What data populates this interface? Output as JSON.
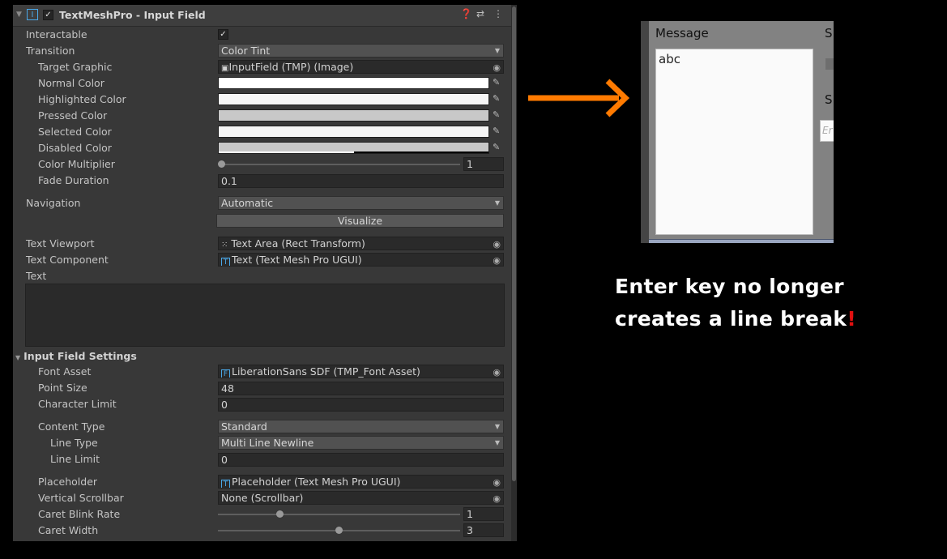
{
  "component": {
    "title": "TextMeshPro - Input Field",
    "icon": "tmp-component-icon",
    "enabled": true,
    "header_icons": [
      "help-icon",
      "presets-icon",
      "menu-icon"
    ]
  },
  "props": {
    "interactable": {
      "label": "Interactable",
      "checked": true
    },
    "transition": {
      "label": "Transition",
      "value": "Color Tint"
    },
    "target_graphic": {
      "label": "Target Graphic",
      "value": "InputField (TMP) (Image)"
    },
    "normal_color": {
      "label": "Normal Color",
      "color": "#ffffff"
    },
    "highlighted_color": {
      "label": "Highlighted Color",
      "color": "#f5f5f5"
    },
    "pressed_color": {
      "label": "Pressed Color",
      "color": "#c8c8c8"
    },
    "selected_color": {
      "label": "Selected Color",
      "color": "#f5f5f5"
    },
    "disabled_color": {
      "label": "Disabled Color",
      "color": "#c8c8c8",
      "alpha": 0.5
    },
    "color_multiplier": {
      "label": "Color Multiplier",
      "value": "1",
      "min": 1,
      "max": 5,
      "current": 1
    },
    "fade_duration": {
      "label": "Fade Duration",
      "value": "0.1"
    },
    "navigation": {
      "label": "Navigation",
      "value": "Automatic"
    },
    "visualize": {
      "label": "Visualize"
    },
    "text_viewport": {
      "label": "Text Viewport",
      "value": "Text Area (Rect Transform)"
    },
    "text_component": {
      "label": "Text Component",
      "value": "Text (Text Mesh Pro UGUI)"
    },
    "text": {
      "label": "Text",
      "value": ""
    }
  },
  "settings": {
    "title": "Input Field Settings",
    "font_asset": {
      "label": "Font Asset",
      "value": "LiberationSans SDF (TMP_Font Asset)"
    },
    "point_size": {
      "label": "Point Size",
      "value": "48"
    },
    "character_limit": {
      "label": "Character Limit",
      "value": "0"
    },
    "content_type": {
      "label": "Content Type",
      "value": "Standard"
    },
    "line_type": {
      "label": "Line Type",
      "value": "Multi Line Newline"
    },
    "line_limit": {
      "label": "Line Limit",
      "value": "0"
    },
    "placeholder": {
      "label": "Placeholder",
      "value": "Placeholder (Text Mesh Pro UGUI)"
    },
    "vertical_scrollbar": {
      "label": "Vertical Scrollbar",
      "value": "None (Scrollbar)"
    },
    "caret_blink_rate": {
      "label": "Caret Blink Rate",
      "value": "1",
      "fraction": 0.25
    },
    "caret_width": {
      "label": "Caret Width",
      "value": "3",
      "fraction": 0.5
    }
  },
  "game_view": {
    "message_label": "Message",
    "message_text": "abc",
    "s1": "S",
    "s2": "S",
    "input_placeholder": "Er"
  },
  "annotation": {
    "line1": "Enter key no longer",
    "line2": "creates a line break",
    "bang": "!",
    "arrow_color": "#ff7a00",
    "bang_color": "#e01010"
  }
}
